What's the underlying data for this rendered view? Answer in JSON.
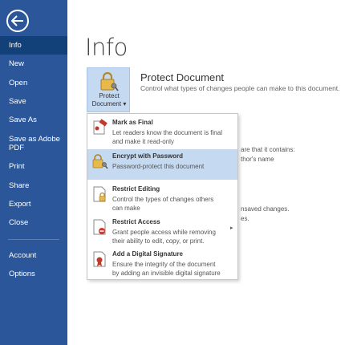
{
  "sidebar": {
    "back_icon": "back-arrow-icon",
    "items": [
      {
        "label": "Info",
        "active": true
      },
      {
        "label": "New"
      },
      {
        "label": "Open"
      },
      {
        "label": "Save"
      },
      {
        "label": "Save As"
      },
      {
        "label": "Save as Adobe PDF"
      },
      {
        "label": "Print"
      },
      {
        "label": "Share"
      },
      {
        "label": "Export"
      },
      {
        "label": "Close"
      }
    ],
    "bottom_items": [
      {
        "label": "Account"
      },
      {
        "label": "Options"
      }
    ]
  },
  "main": {
    "title": "Info",
    "protect": {
      "button_label_1": "Protect",
      "button_label_2": "Document ▾",
      "title": "Protect Document",
      "description": "Control what types of changes people can make to this document."
    },
    "background_fragments": {
      "line1": "are that it contains:",
      "line2": "thor's name",
      "line3": "nsaved changes.",
      "line4": "es."
    }
  },
  "menu": {
    "items": [
      {
        "title": "Mark as Final",
        "desc1": "Let readers know the document is final",
        "desc2": "and make it read-only",
        "icon": "mark-final-icon"
      },
      {
        "title": "Encrypt with Password",
        "desc1": "Password-protect this document",
        "desc2": "",
        "icon": "lock-key-icon"
      },
      {
        "title": "Restrict Editing",
        "desc1": "Control the types of changes others",
        "desc2": "can make",
        "icon": "restrict-editing-icon"
      },
      {
        "title": "Restrict Access",
        "desc1": "Grant people access while removing",
        "desc2": "their ability to edit, copy, or print.",
        "icon": "restrict-access-icon"
      },
      {
        "title": "Add a Digital Signature",
        "desc1": "Ensure the integrity of the document",
        "desc2": "by adding an invisible digital signature",
        "icon": "digital-signature-icon"
      }
    ]
  },
  "colors": {
    "sidebar": "#2b579a",
    "active": "#124078",
    "highlight": "#c5d9f1"
  }
}
